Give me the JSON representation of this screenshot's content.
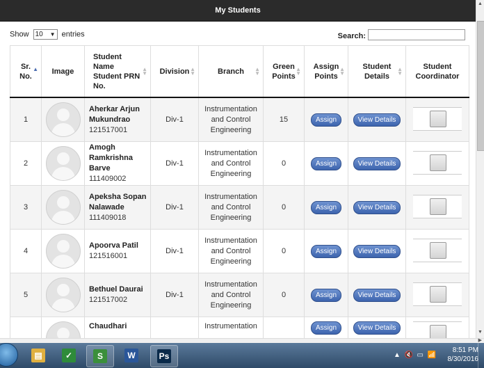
{
  "header": {
    "title": "My Students"
  },
  "controls": {
    "show_label": "Show",
    "entries_value": "10",
    "entries_label": "entries",
    "search_label": "Search:",
    "search_value": ""
  },
  "table": {
    "columns": {
      "sr_no": [
        "Sr.",
        "No."
      ],
      "image": "Image",
      "student": [
        "Student",
        "Name",
        "Student PRN",
        "No."
      ],
      "division": "Division",
      "branch": "Branch",
      "green_points": [
        "Green",
        "Points"
      ],
      "assign_points": [
        "Assign",
        "Points"
      ],
      "student_details": [
        "Student",
        "Details"
      ],
      "student_coordinator": [
        "Student",
        "Coordinator"
      ]
    },
    "assign_label": "Assign",
    "view_label": "View Details",
    "rows": [
      {
        "sr": "1",
        "name": [
          "Aherkar Arjun",
          "Mukundrao"
        ],
        "prn": "121517001",
        "division": "Div-1",
        "branch": [
          "Instrumentation",
          "and Control",
          "Engineering"
        ],
        "points": "15"
      },
      {
        "sr": "2",
        "name": [
          "Amogh",
          "Ramkrishna",
          "Barve"
        ],
        "prn": "111409002",
        "division": "Div-1",
        "branch": [
          "Instrumentation",
          "and Control",
          "Engineering"
        ],
        "points": "0"
      },
      {
        "sr": "3",
        "name": [
          "Apeksha Sopan",
          "Nalawade"
        ],
        "prn": "111409018",
        "division": "Div-1",
        "branch": [
          "Instrumentation",
          "and Control",
          "Engineering"
        ],
        "points": "0"
      },
      {
        "sr": "4",
        "name": [
          "Apoorva Patil"
        ],
        "prn": "121516001",
        "division": "Div-1",
        "branch": [
          "Instrumentation",
          "and Control",
          "Engineering"
        ],
        "points": "0"
      },
      {
        "sr": "5",
        "name": [
          "Bethuel Daurai"
        ],
        "prn": "121517002",
        "division": "Div-1",
        "branch": [
          "Instrumentation",
          "and Control",
          "Engineering"
        ],
        "points": "0"
      },
      {
        "sr": "",
        "name": [
          "Chaudhari"
        ],
        "prn": "",
        "division": "",
        "branch": [
          "Instrumentation"
        ],
        "points": ""
      }
    ]
  },
  "taskbar": {
    "apps": [
      {
        "icon": "file-explorer-icon",
        "glyph": "▤",
        "color": "#e0b040",
        "active": false
      },
      {
        "icon": "chart-app-icon",
        "glyph": "✓",
        "color": "#2e8b3a",
        "active": false
      },
      {
        "icon": "presentation-app-icon",
        "glyph": "S",
        "color": "#3b8f3b",
        "active": true
      },
      {
        "icon": "word-icon",
        "glyph": "W",
        "color": "#2a5699",
        "active": false
      },
      {
        "icon": "photoshop-icon",
        "glyph": "Ps",
        "color": "#0a2a4a",
        "active": true
      }
    ],
    "time": "8:51 PM",
    "date": "8/30/2016"
  }
}
